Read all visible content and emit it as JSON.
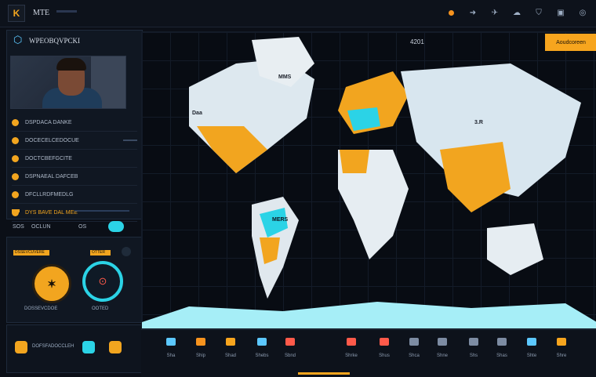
{
  "app": {
    "title": "MTE",
    "logo": "K"
  },
  "top_icons": [
    "orange-dot-icon",
    "link-icon",
    "send-icon",
    "cloud-icon",
    "shield-icon",
    "image-icon",
    "globe-icon"
  ],
  "left_panel": {
    "title": "WPEOBQVPCKI",
    "list": [
      {
        "label": "DSPDACA DANKE"
      },
      {
        "label": "DOCECELCEDOCUE"
      },
      {
        "label": "DOCTCBEFGCITE"
      },
      {
        "label": "DSPNAEAL DAFCEB"
      },
      {
        "label": "DFCLLRDFMEDLG"
      },
      {
        "label": "DYS BAVE DAL MEE",
        "active": true
      }
    ]
  },
  "mid_row": {
    "left": "SOS",
    "mid": "OCLUN",
    "count": "OS"
  },
  "stats": {
    "tag_left": "DSSEVCUVERE",
    "tag_right": "OTTER",
    "label_left": "DOSSEVCDOE",
    "label_right": "OOTED"
  },
  "bottom_left": {
    "label": "DOFSFADOCCLEH"
  },
  "map": {
    "title": "4201",
    "alert": "Aoudcoreen",
    "labels": [
      {
        "text": "MMS"
      },
      {
        "text": "Daa"
      },
      {
        "text": "3.R"
      },
      {
        "text": "MERS"
      }
    ]
  },
  "bottom_items": [
    {
      "label": "Sha",
      "color": "#5cc8ff"
    },
    {
      "label": "Ship",
      "color": "#f7931e"
    },
    {
      "label": "Shad",
      "color": "#f7a51e"
    },
    {
      "label": "Shebs",
      "color": "#5cc8ff"
    },
    {
      "label": "Sbnd",
      "color": "#ff5a4a"
    },
    {
      "label": "Shrke",
      "color": "#ff5a4a"
    },
    {
      "label": "Shus",
      "color": "#ff5a4a"
    },
    {
      "label": "Shca",
      "color": "#7d8ca3"
    },
    {
      "label": "Shne",
      "color": "#7d8ca3"
    },
    {
      "label": "Shs",
      "color": "#7d8ca3"
    },
    {
      "label": "Shas",
      "color": "#7d8ca3"
    },
    {
      "label": "Shte",
      "color": "#5cc8ff"
    },
    {
      "label": "Shre",
      "color": "#f7a51e"
    }
  ]
}
